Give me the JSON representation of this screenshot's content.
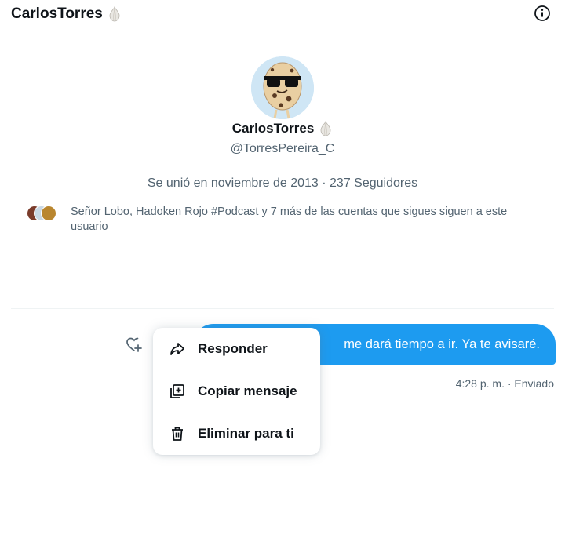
{
  "header": {
    "name": "CarlosTorres"
  },
  "profile": {
    "name": "CarlosTorres",
    "handle": "@TorresPereira_C",
    "joined": "Se unió en noviembre de 2013 · 237 Seguidores",
    "followers_known": "Señor Lobo, Hadoken Rojo #Podcast y 7 más de las cuentas que sigues siguen a este usuario"
  },
  "message": {
    "text": "me dará tiempo a ir. Ya te avisaré.",
    "meta": "4:28 p. m. · Enviado"
  },
  "menu": {
    "items": [
      {
        "label": "Responder",
        "icon": "reply-icon"
      },
      {
        "label": "Copiar mensaje",
        "icon": "copy-icon"
      },
      {
        "label": "Eliminar para ti",
        "icon": "trash-icon"
      }
    ]
  },
  "colors": {
    "accent": "#1d9bf0",
    "muted": "#536471",
    "text": "#0f1419"
  }
}
